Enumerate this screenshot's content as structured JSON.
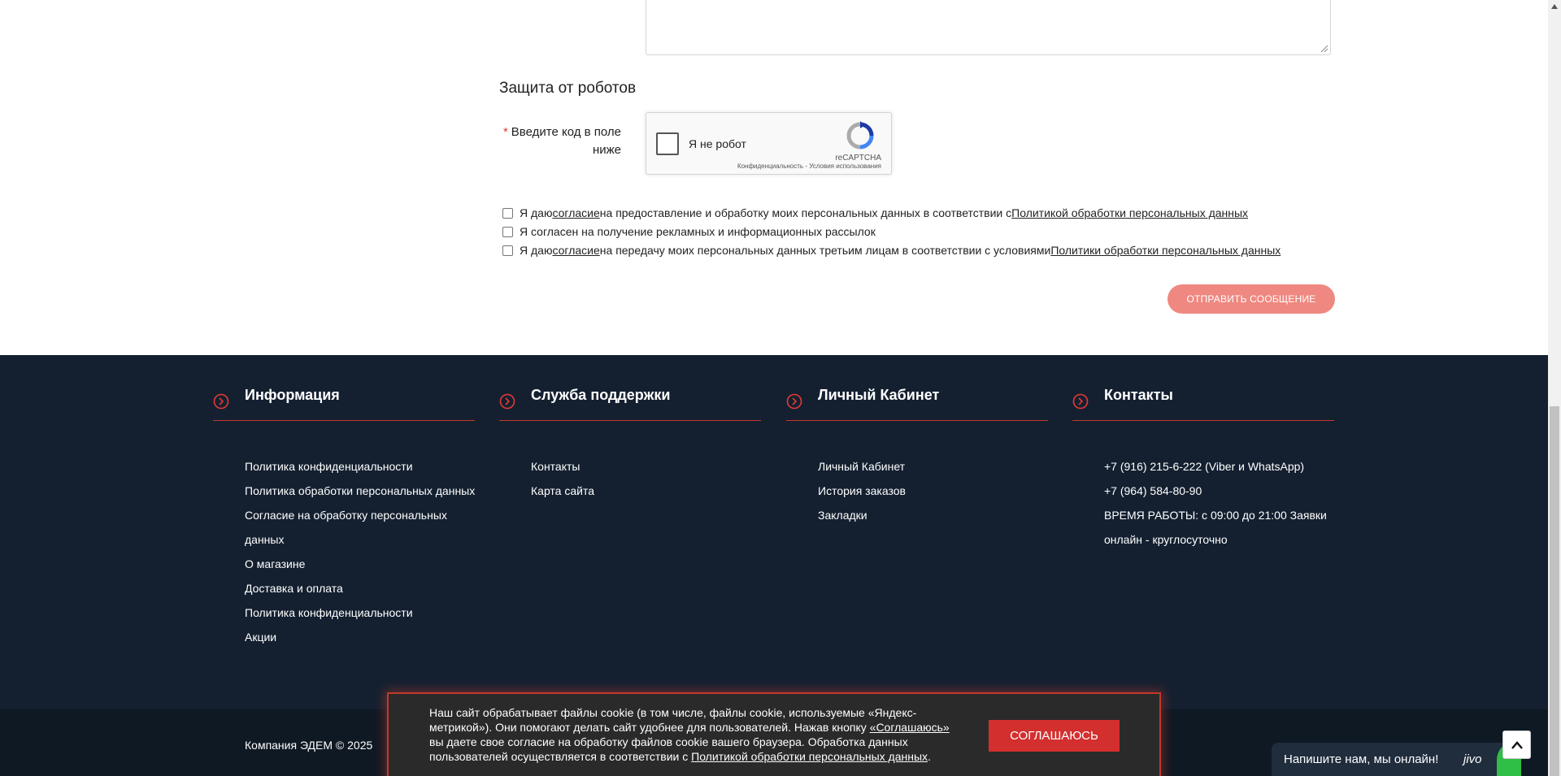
{
  "robots_section": {
    "title": "Защита от роботов",
    "captcha_label_req": "*",
    "captcha_label": "Введите код в поле ниже",
    "recaptcha_checkbox_label": "Я не робот",
    "recaptcha_brand": "reCAPTCHA",
    "recaptcha_terms": "Конфиденциальность - Условия использования"
  },
  "consents": [
    {
      "pre": "Я даю ",
      "link1": "согласие",
      "mid": " на предоставление и обработку моих персональных данных в соответствии с ",
      "link2": "Политикой обработки персональных данных",
      "checked": false
    },
    {
      "text": "Я согласен на получение рекламных и информационных рассылок",
      "checked": false
    },
    {
      "pre": "Я даю ",
      "link1": "согласие",
      "mid": " на передачу моих персональных данных третьим лицам в соответствии с условиями ",
      "link2": "Политики обработки персональных данных",
      "checked": false
    }
  ],
  "send_button": "Отправить сообщение",
  "footer": {
    "columns": [
      {
        "title": "Информация",
        "links": [
          "Политика конфиденциальности",
          "Политика обработки персональных данных",
          "Согласие на обработку персональных данных",
          "О магазине",
          "Доставка и оплата",
          "Политика конфиденциальности",
          "Акции"
        ]
      },
      {
        "title": "Служба поддержки",
        "links": [
          "Контакты",
          "Карта сайта"
        ]
      },
      {
        "title": "Личный Кабинет",
        "links": [
          "Личный Кабинет",
          "История заказов",
          "Закладки"
        ]
      },
      {
        "title": "Контакты",
        "links": [
          "+7 (916) 215-6-222 (Viber и WhatsApp)",
          "+7 (964) 584-80-90",
          "ВРЕМЯ РАБОТЫ: с 09:00 до 21:00 Заявки онлайн - круглосуточно"
        ]
      }
    ],
    "copyright": "Компания ЭДЕМ © 2025"
  },
  "cookie_banner": {
    "text": "Наш сайт обрабатывает файлы cookie (в том числе, файлы cookie, используемые «Яндекс-метрикой»). Они помогают делать сайт удобнее для пользователей. Нажав кнопку ",
    "agree_link": "«Соглашаюсь»",
    "text2": " вы даете свое согласие на обработку файлов cookie вашего браузера. Обработка данных пользователей осуществляется в соответствии с ",
    "policy_link": "Политикой обработки персональных данных",
    "text3": ".",
    "button": "СОГЛАШАЮСЬ"
  },
  "chat_widget": {
    "message": "Напишите нам, мы онлайн!",
    "brand": "jivo"
  },
  "colors": {
    "accent": "#c0392b",
    "footer_bg": "#142030",
    "send_button": "#ef8880",
    "cookie_button": "#d32f2f"
  },
  "icons": [
    "chevron-right-circle-icon",
    "recaptcha-logo-icon",
    "arrow-up-icon",
    "resize-grip-icon"
  ]
}
